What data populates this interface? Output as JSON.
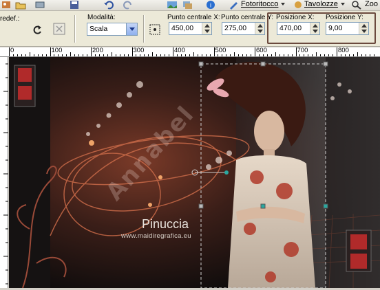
{
  "menu": {
    "item1_label": "Fotoritocco",
    "item2_label": "Tavolozze",
    "item3_label": "Zoo",
    "left_partial": "redef.:"
  },
  "options": {
    "mode_label": "Modalità:",
    "mode_value": "Scala",
    "center_x_label": "Punto centrale X:",
    "center_x_value": "450,00",
    "center_y_label": "Punto centrale Y:",
    "center_y_value": "275,00",
    "pos_x_label": "Posizione X:",
    "pos_x_value": "470,00",
    "pos_y_label": "Posizione Y:",
    "pos_y_value": "9,00"
  },
  "ruler": {
    "labels": [
      "0",
      "100",
      "200",
      "300",
      "400",
      "500",
      "600",
      "700",
      "800"
    ]
  },
  "canvas": {
    "watermark_text": "Annabel",
    "signature": "Pinuccia",
    "site": "www.maidiregrafica.eu"
  },
  "colors": {
    "toolbar_bg": "#ece9d8",
    "highlight_border": "#6b4a3e",
    "accent_copper": "#b5583a"
  }
}
